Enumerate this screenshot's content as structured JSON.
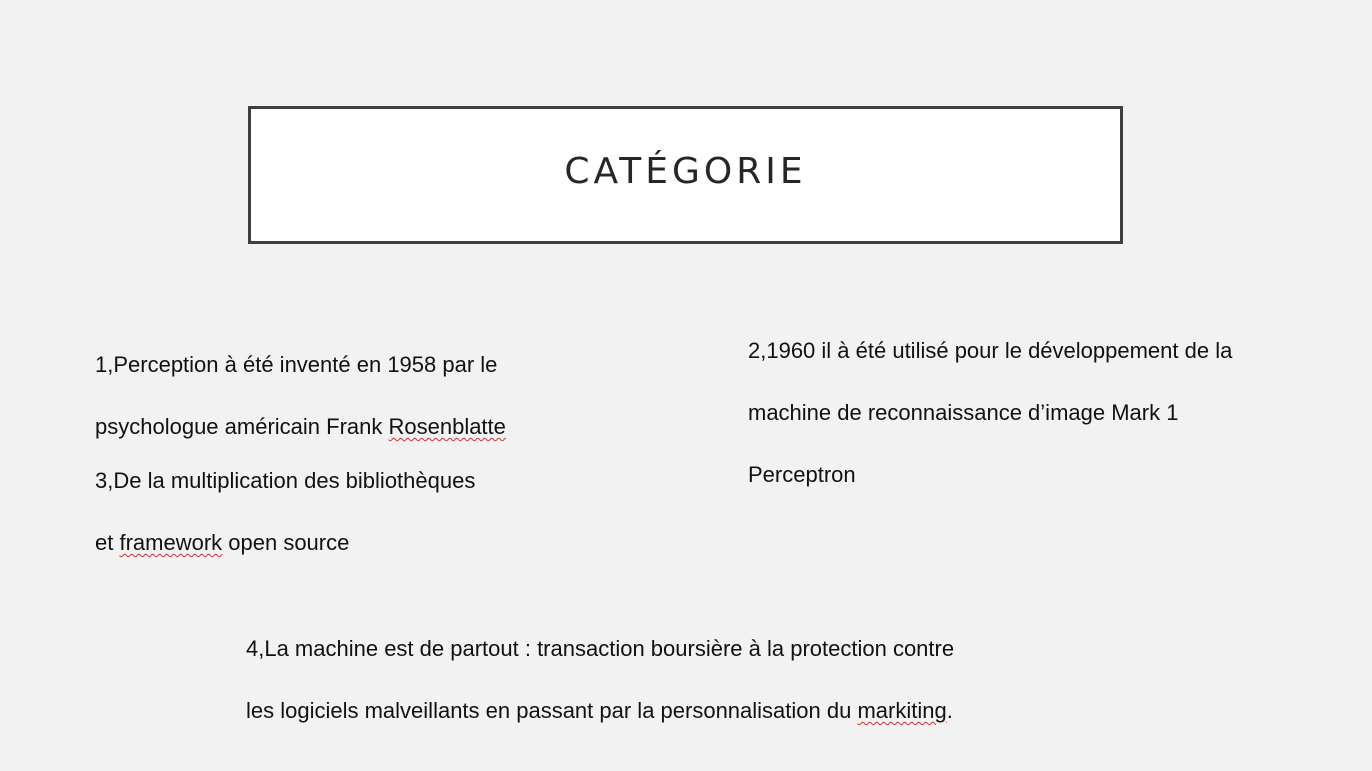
{
  "title": "CATÉGORIE",
  "paragraphs": {
    "p1": {
      "line1": "1,Perception à été inventé en 1958 par le",
      "line2_before": "psychologue américain Frank ",
      "line2_flagged": "Rosenblatte"
    },
    "p2": {
      "line1": "2,1960 il à été utilisé pour le développement de la",
      "line2": "machine de reconnaissance d’image Mark 1",
      "line3": "Perceptron"
    },
    "p3": {
      "line1": "3,De la multiplication des bibliothèques",
      "line2_before": "et ",
      "line2_flagged": "framework",
      "line2_after": " open source"
    },
    "p4": {
      "line1": "4,La machine est de partout : transaction boursière à la protection contre",
      "line2_before": "les logiciels malveillants en passant par la personnalisation du ",
      "line2_flagged": "markiting",
      "line2_after": "."
    }
  },
  "colors": {
    "background": "#f2f2f2",
    "title_border": "#3f3f3f",
    "spellcheck_underline": "#d23030"
  }
}
